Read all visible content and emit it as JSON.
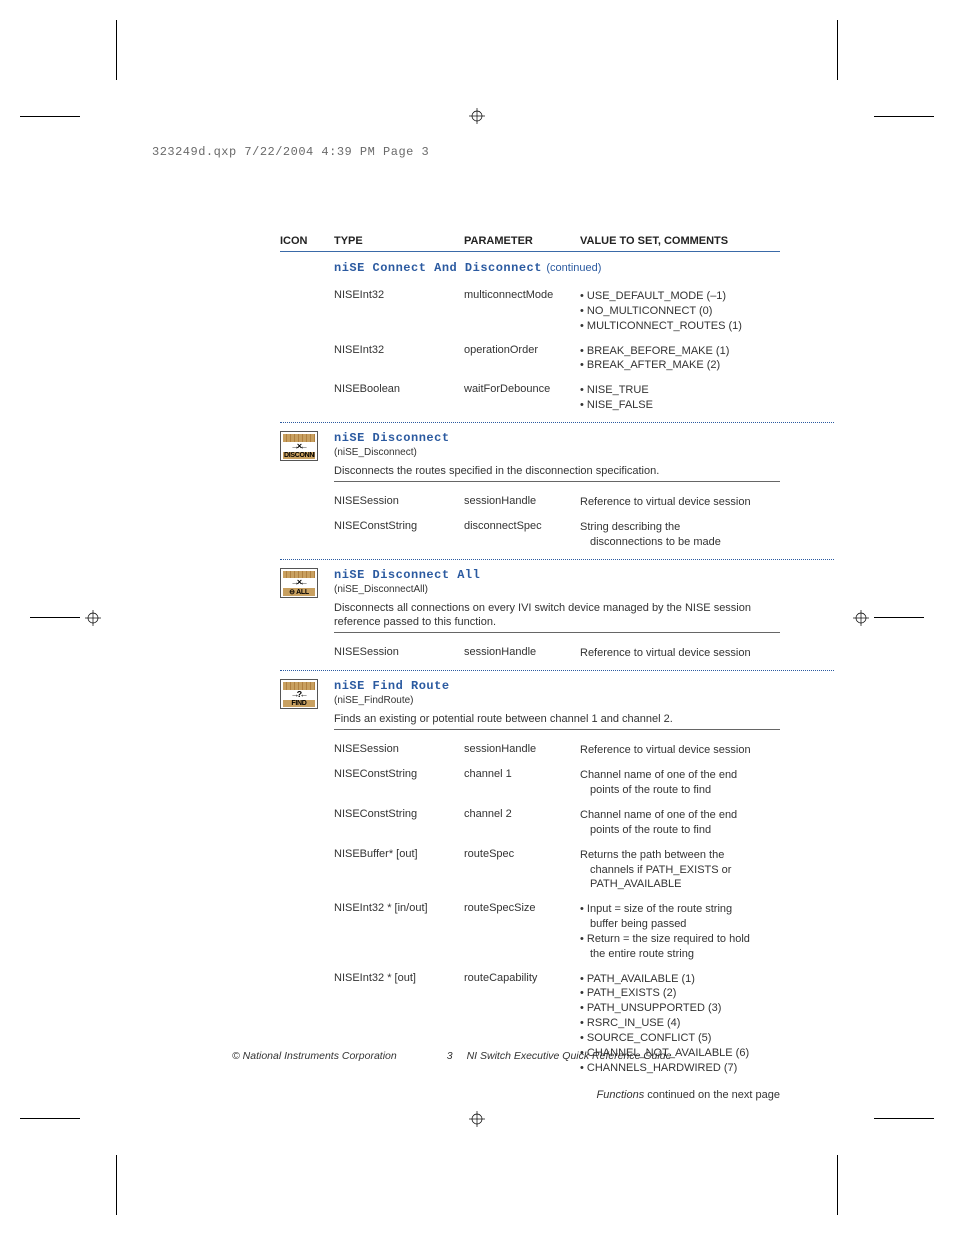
{
  "header": {
    "slug": "323249d.qxp  7/22/2004  4:39 PM  Page 3"
  },
  "columns": {
    "icon": "ICON",
    "type": "TYPE",
    "parameter": "PARAMETER",
    "value": "VALUE TO SET, COMMENTS"
  },
  "sections": [
    {
      "id": "connect-and-disconnect",
      "title": "niSE Connect And Disconnect",
      "continued": "(continued)",
      "rows": [
        {
          "type": "NISEInt32",
          "param": "multiconnectMode",
          "bullets": [
            "USE_DEFAULT_MODE (–1)",
            "NO_MULTICONNECT (0)",
            "MULTICONNECT_ROUTES (1)"
          ]
        },
        {
          "type": "NISEInt32",
          "param": "operationOrder",
          "bullets": [
            "BREAK_BEFORE_MAKE (1)",
            "BREAK_AFTER_MAKE (2)"
          ]
        },
        {
          "type": "NISEBoolean",
          "param": "waitForDebounce",
          "bullets": [
            "NISE_TRUE",
            "NISE_FALSE"
          ]
        }
      ]
    },
    {
      "id": "disconnect",
      "title": "niSE Disconnect",
      "cname": "(niSE_Disconnect)",
      "desc": "Disconnects the routes specified in the disconnection specification.",
      "icon_mid": "→×←",
      "icon_label": "DISCONNECT",
      "rows": [
        {
          "type": "NISESession",
          "param": "sessionHandle",
          "value": "Reference to virtual device session"
        },
        {
          "type": "NISEConstString",
          "param": "disconnectSpec",
          "value": "String describing the",
          "value2": "disconnections to be made"
        }
      ]
    },
    {
      "id": "disconnect-all",
      "title": "niSE Disconnect All",
      "cname": "(niSE_DisconnectAll)",
      "desc": "Disconnects all connections on every IVI switch device managed by the NISE session reference passed to this function.",
      "icon_mid": "→×←",
      "icon_label": "⊖ ALL",
      "rows": [
        {
          "type": "NISESession",
          "param": "sessionHandle",
          "value": "Reference to virtual device session"
        }
      ]
    },
    {
      "id": "find-route",
      "title": "niSE Find Route",
      "cname": "(niSE_FindRoute)",
      "desc": "Finds an existing or potential route between channel 1 and channel 2.",
      "icon_mid": "→?←",
      "icon_label": "FIND",
      "rows": [
        {
          "type": "NISESession",
          "param": "sessionHandle",
          "value": "Reference to virtual device session"
        },
        {
          "type": "NISEConstString",
          "param": "channel 1",
          "value": "Channel name of one of the end",
          "value2": "points of the route to find"
        },
        {
          "type": "NISEConstString",
          "param": "channel 2",
          "value": "Channel name of one of the end",
          "value2": "points of the route to find"
        },
        {
          "type": "NISEBuffer* [out]",
          "param": "routeSpec",
          "value": "Returns the path between the",
          "value2": "channels if PATH_EXISTS or",
          "value3": "PATH_AVAILABLE"
        },
        {
          "type": "NISEInt32 * [in/out]",
          "param": "routeSpecSize",
          "bullets": [
            "Input = size of the route string"
          ],
          "bulletIndent": [
            "buffer being passed"
          ],
          "bullets2": [
            "Return = the size required to hold"
          ],
          "bullet2Indent": [
            "the entire route string"
          ]
        },
        {
          "type": "NISEInt32 * [out]",
          "param": "routeCapability",
          "bullets": [
            "PATH_AVAILABLE (1)",
            "PATH_EXISTS (2)",
            "PATH_UNSUPPORTED (3)",
            "RSRC_IN_USE (4)",
            "SOURCE_CONFLICT (5)",
            "CHANNEL_NOT_AVAILABLE (6)",
            "CHANNELS_HARDWIRED (7)"
          ]
        }
      ]
    }
  ],
  "footerNote": {
    "italic": "Functions",
    "rest": " continued on the next page"
  },
  "footer": {
    "copyright": "© National Instruments Corporation",
    "pageNum": "3",
    "docTitle": "NI Switch Executive Quick Reference Guide"
  }
}
